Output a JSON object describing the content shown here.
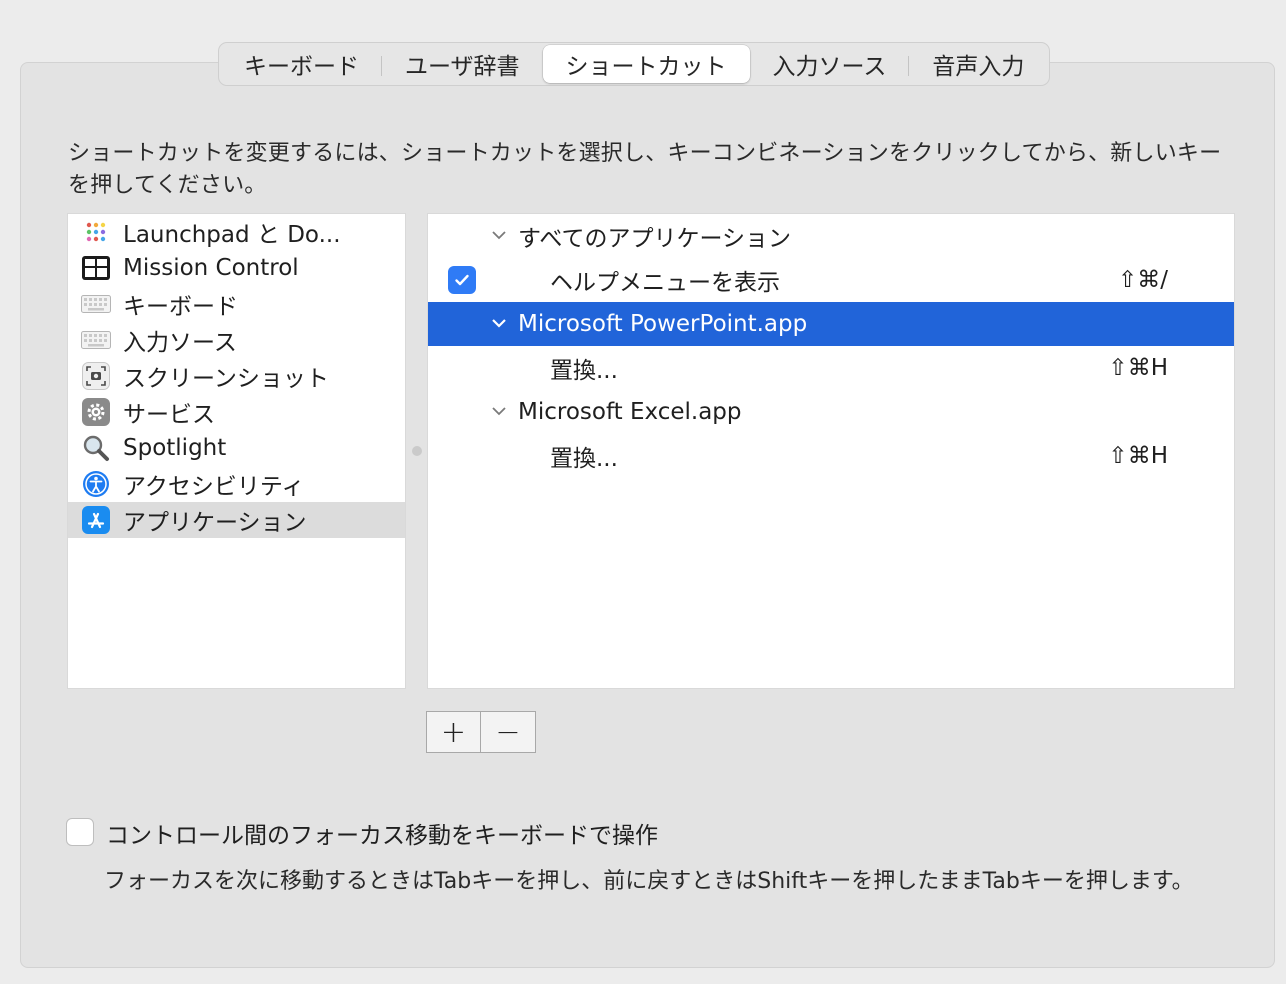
{
  "tabs": [
    {
      "label": "キーボード"
    },
    {
      "label": "ユーザ辞書"
    },
    {
      "label": "ショートカット",
      "active": true
    },
    {
      "label": "入力ソース"
    },
    {
      "label": "音声入力"
    }
  ],
  "instructions": "ショートカットを変更するには、ショートカットを選択し、キーコンビネーションをクリックしてから、新しいキーを押してください。",
  "categories": [
    {
      "label": "Launchpad と Do...",
      "icon": "launchpad-icon"
    },
    {
      "label": "Mission Control",
      "icon": "mission-control-icon"
    },
    {
      "label": "キーボード",
      "icon": "keyboard-icon"
    },
    {
      "label": "入力ソース",
      "icon": "keyboard-icon"
    },
    {
      "label": "スクリーンショット",
      "icon": "screenshot-icon"
    },
    {
      "label": "サービス",
      "icon": "gear-icon"
    },
    {
      "label": "Spotlight",
      "icon": "magnifier-icon"
    },
    {
      "label": "アクセシビリティ",
      "icon": "accessibility-icon"
    },
    {
      "label": "アプリケーション",
      "icon": "app-store-icon",
      "selected": true
    }
  ],
  "shortcuts": [
    {
      "type": "group",
      "label": "すべてのアプリケーション"
    },
    {
      "type": "item",
      "label": "ヘルプメニューを表示",
      "key": "⇧⌘/",
      "checked": true
    },
    {
      "type": "group",
      "label": "Microsoft PowerPoint.app",
      "selected": true
    },
    {
      "type": "item",
      "label": "置換...",
      "key": "⇧⌘H"
    },
    {
      "type": "group",
      "label": "Microsoft Excel.app"
    },
    {
      "type": "item",
      "label": "置換...",
      "key": "⇧⌘H"
    }
  ],
  "buttons": {
    "add": "+",
    "remove": "−"
  },
  "keyboard_nav": {
    "label": "コントロール間のフォーカス移動をキーボードで操作",
    "checked": false,
    "hint": "フォーカスを次に移動するときはTabキーを押し、前に戻すときはShiftキーを押したままTabキーを押します。"
  },
  "colors": {
    "selection": "#2164D9",
    "checkbox": "#2F7BF6",
    "panel": "#E3E3E3"
  }
}
